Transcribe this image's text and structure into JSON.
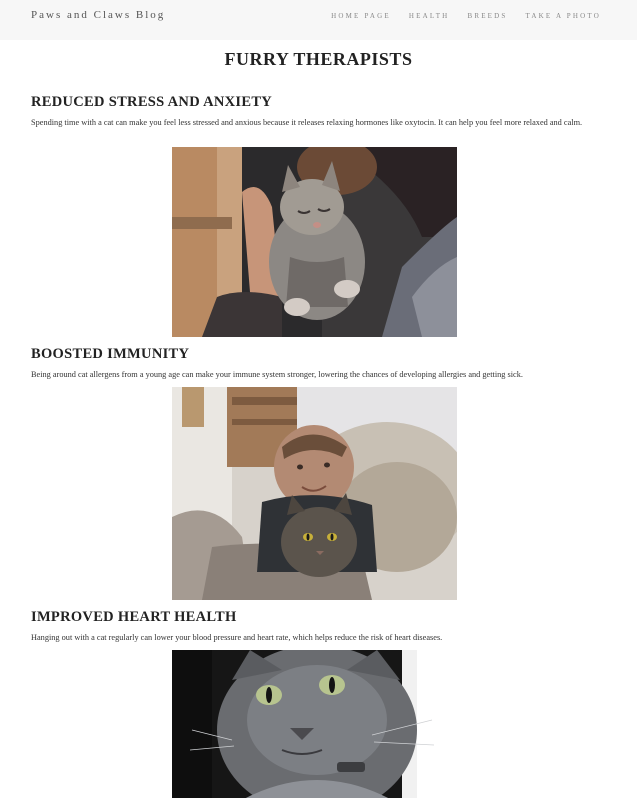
{
  "nav": {
    "brand": "Paws and Claws Blog",
    "links": [
      "HOME PAGE",
      "HEALTH",
      "BREEDS",
      "TAKE A PHOTO"
    ]
  },
  "page": {
    "title": "FURRY THERAPISTS"
  },
  "sections": [
    {
      "heading": "REDUCED STRESS AND ANXIETY",
      "text": "Spending time with a cat can make you feel less stressed and anxious because it releases relaxing hormones like oxytocin. It can help you feel more relaxed and calm."
    },
    {
      "heading": "BOOSTED IMMUNITY",
      "text": "Being around cat allergens from a young age can make your immune system stronger, lowering the chances of developing allergies and getting sick."
    },
    {
      "heading": "IMPROVED HEART HEALTH",
      "text": "Hanging out with a cat regularly can lower your blood pressure and heart rate, which helps reduce the risk of heart diseases."
    }
  ]
}
